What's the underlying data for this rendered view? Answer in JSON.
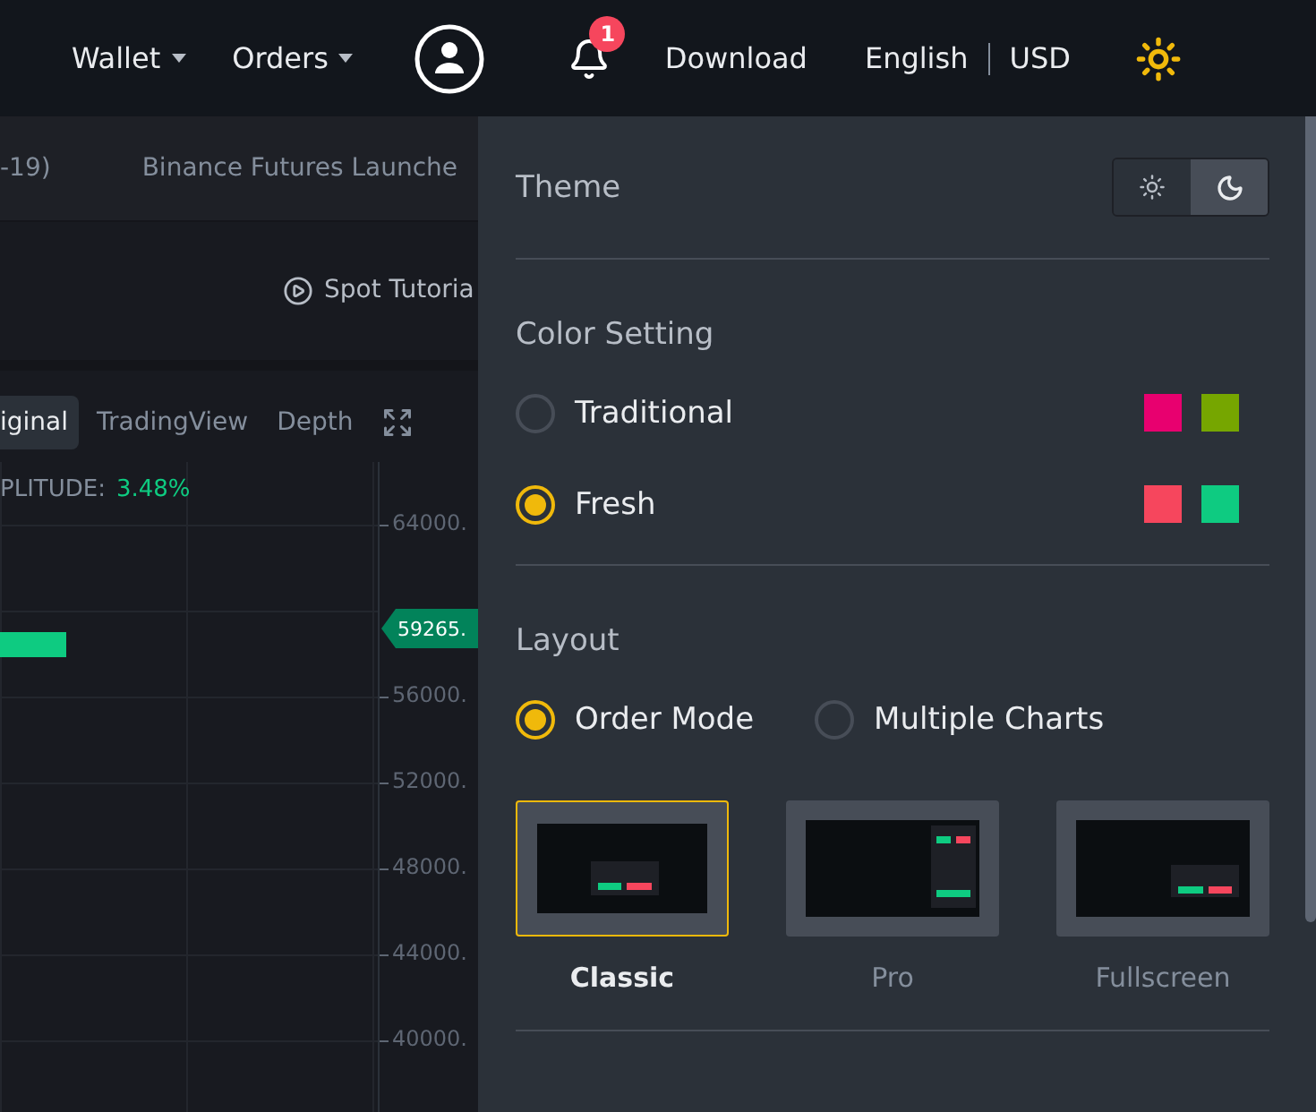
{
  "top_nav": {
    "menus": [
      {
        "label": "Wallet"
      },
      {
        "label": "Orders"
      }
    ],
    "notifications": {
      "count": "1"
    },
    "links": [
      {
        "label": "Download"
      }
    ],
    "language": "English",
    "currency": "USD"
  },
  "ticker": {
    "items": [
      "-19)",
      "Binance Futures Launche"
    ]
  },
  "tutorial_link": "Spot Tutoria",
  "chart_tabs": [
    {
      "label": "iginal",
      "selected": true
    },
    {
      "label": "TradingView",
      "selected": false
    },
    {
      "label": "Depth",
      "selected": false
    }
  ],
  "chart": {
    "amplitude_label": "PLITUDE:",
    "amplitude_value": "3.48%",
    "last_price": "59265.",
    "price_axis": [
      "64000.",
      "56000.",
      "52000.",
      "48000.",
      "44000.",
      "40000."
    ]
  },
  "settings_panel": {
    "theme": {
      "label": "Theme",
      "options": [
        {
          "kind": "light",
          "selected": false
        },
        {
          "kind": "dark",
          "selected": true
        }
      ]
    },
    "color_setting": {
      "title": "Color Setting",
      "options": [
        {
          "label": "Traditional",
          "selected": false,
          "swatches": [
            {
              "color": "#e8006f"
            },
            {
              "color": "#76a600"
            }
          ]
        },
        {
          "label": "Fresh",
          "selected": true,
          "swatches": [
            {
              "color": "#f6465d"
            },
            {
              "color": "#0ecb81"
            }
          ]
        }
      ]
    },
    "layout": {
      "title": "Layout",
      "modes": [
        {
          "label": "Order Mode",
          "selected": true
        },
        {
          "label": "Multiple Charts",
          "selected": false
        }
      ],
      "presets": [
        {
          "label": "Classic",
          "kind": "classic",
          "selected": true
        },
        {
          "label": "Pro",
          "kind": "pro",
          "selected": false
        },
        {
          "label": "Fullscreen",
          "kind": "fullscreen",
          "selected": false
        }
      ]
    }
  }
}
